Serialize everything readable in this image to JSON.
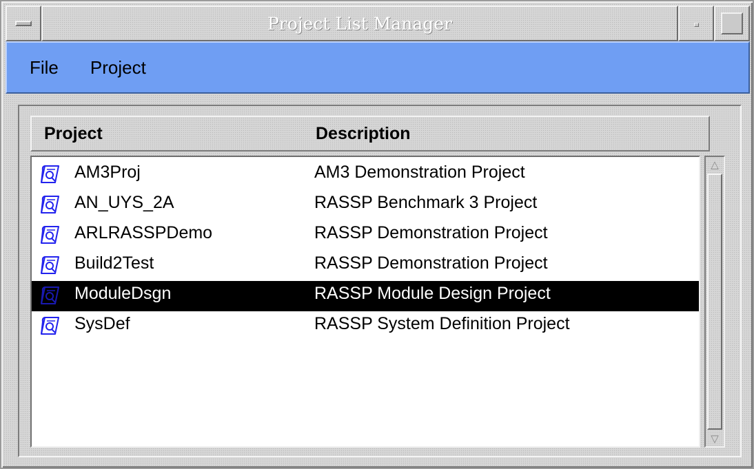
{
  "window": {
    "title": "Project List Manager"
  },
  "menubar": {
    "items": [
      {
        "label": "File"
      },
      {
        "label": "Project"
      }
    ]
  },
  "table": {
    "columns": [
      "Project",
      "Description"
    ],
    "rows": [
      {
        "name": "AM3Proj",
        "description": "AM3 Demonstration Project",
        "selected": false
      },
      {
        "name": "AN_UYS_2A",
        "description": "RASSP Benchmark 3 Project",
        "selected": false
      },
      {
        "name": "ARLRASSPDemo",
        "description": "RASSP Demonstration Project",
        "selected": false
      },
      {
        "name": "Build2Test",
        "description": "RASSP Demonstration Project",
        "selected": false
      },
      {
        "name": "ModuleDsgn",
        "description": "RASSP Module Design Project",
        "selected": true
      },
      {
        "name": "SysDef",
        "description": "RASSP System Definition Project",
        "selected": false
      }
    ],
    "row_icon": "project-document-icon"
  },
  "colors": {
    "menubar": "#6f9ef3",
    "selection": "#000000",
    "icon": "#2222ee"
  }
}
